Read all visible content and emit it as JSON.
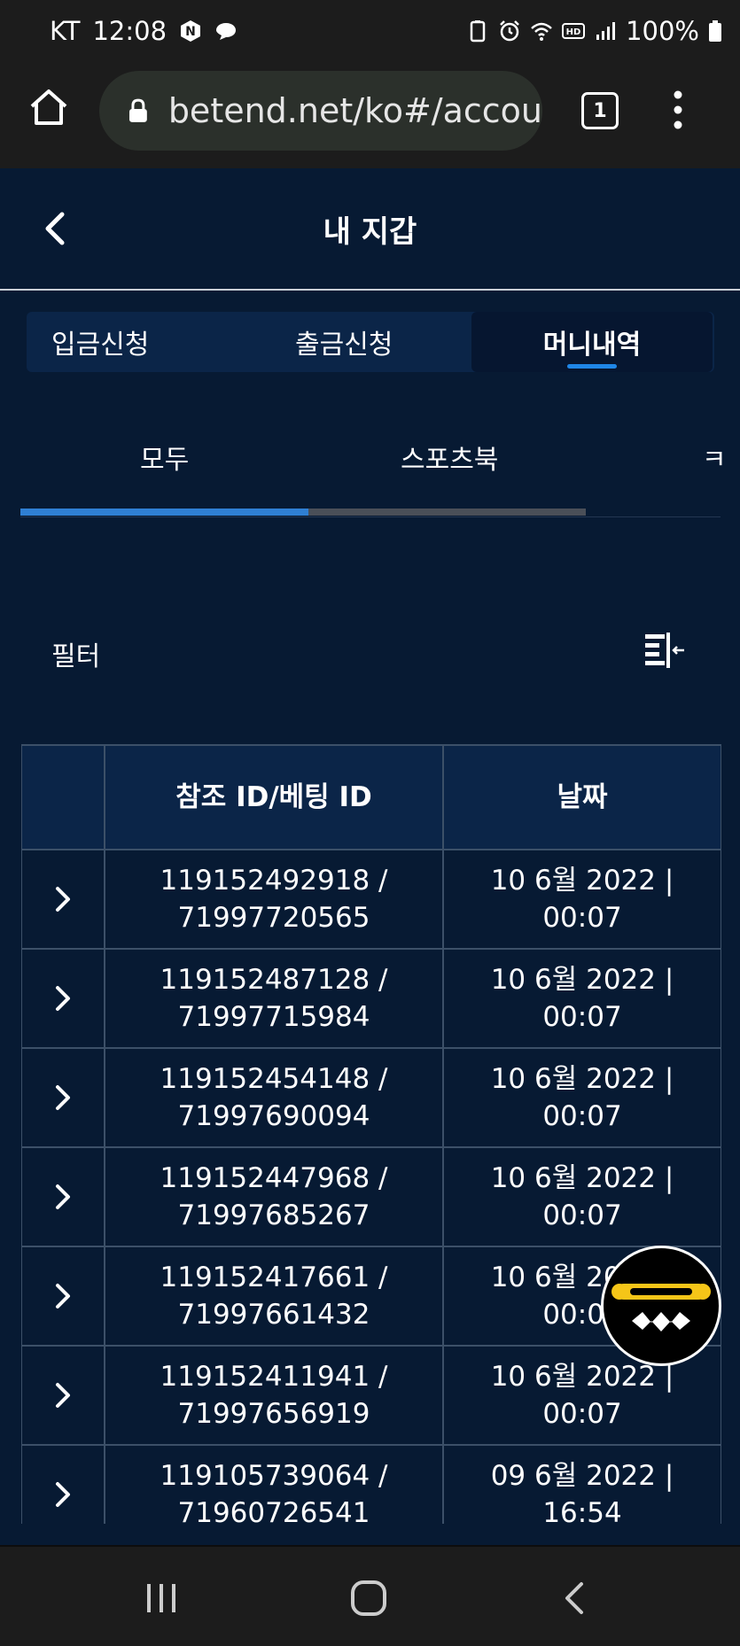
{
  "status_bar": {
    "carrier": "KT",
    "time": "12:08",
    "battery": "100%"
  },
  "browser": {
    "url": "betend.net/ko#/accou",
    "tab_count": "1"
  },
  "page": {
    "title": "내 지갑"
  },
  "segment_tabs": [
    {
      "label": "입금신청",
      "active": false
    },
    {
      "label": "출금신청",
      "active": false
    },
    {
      "label": "머니내역",
      "active": true
    }
  ],
  "sub_tabs": [
    {
      "label": "모두",
      "active": true
    },
    {
      "label": "스포츠북",
      "active": false
    },
    {
      "label": "ㅋ",
      "active": false
    }
  ],
  "filter": {
    "label": "필터"
  },
  "table": {
    "headers": [
      "",
      "참조 ID/베팅 ID",
      "날짜"
    ],
    "rows": [
      {
        "ref": "119152492918 /",
        "bet": "71997720565",
        "date": "10 6월 2022 |",
        "time": "00:07"
      },
      {
        "ref": "119152487128 /",
        "bet": "71997715984",
        "date": "10 6월 2022 |",
        "time": "00:07"
      },
      {
        "ref": "119152454148 /",
        "bet": "71997690094",
        "date": "10 6월 2022 |",
        "time": "00:07"
      },
      {
        "ref": "119152447968 /",
        "bet": "71997685267",
        "date": "10 6월 2022 |",
        "time": "00:07"
      },
      {
        "ref": "119152417661 /",
        "bet": "71997661432",
        "date": "10 6월 2022 |",
        "time": "00:07"
      },
      {
        "ref": "119152411941 /",
        "bet": "71997656919",
        "date": "10 6월 2022 |",
        "time": "00:07"
      },
      {
        "ref": "119105739064 /",
        "bet": "71960726541",
        "date": "09 6월 2022 |",
        "time": "16:54"
      }
    ]
  },
  "colors": {
    "background": "#071a33",
    "accent": "#1f86e6",
    "chat_yellow": "#f5c518"
  }
}
